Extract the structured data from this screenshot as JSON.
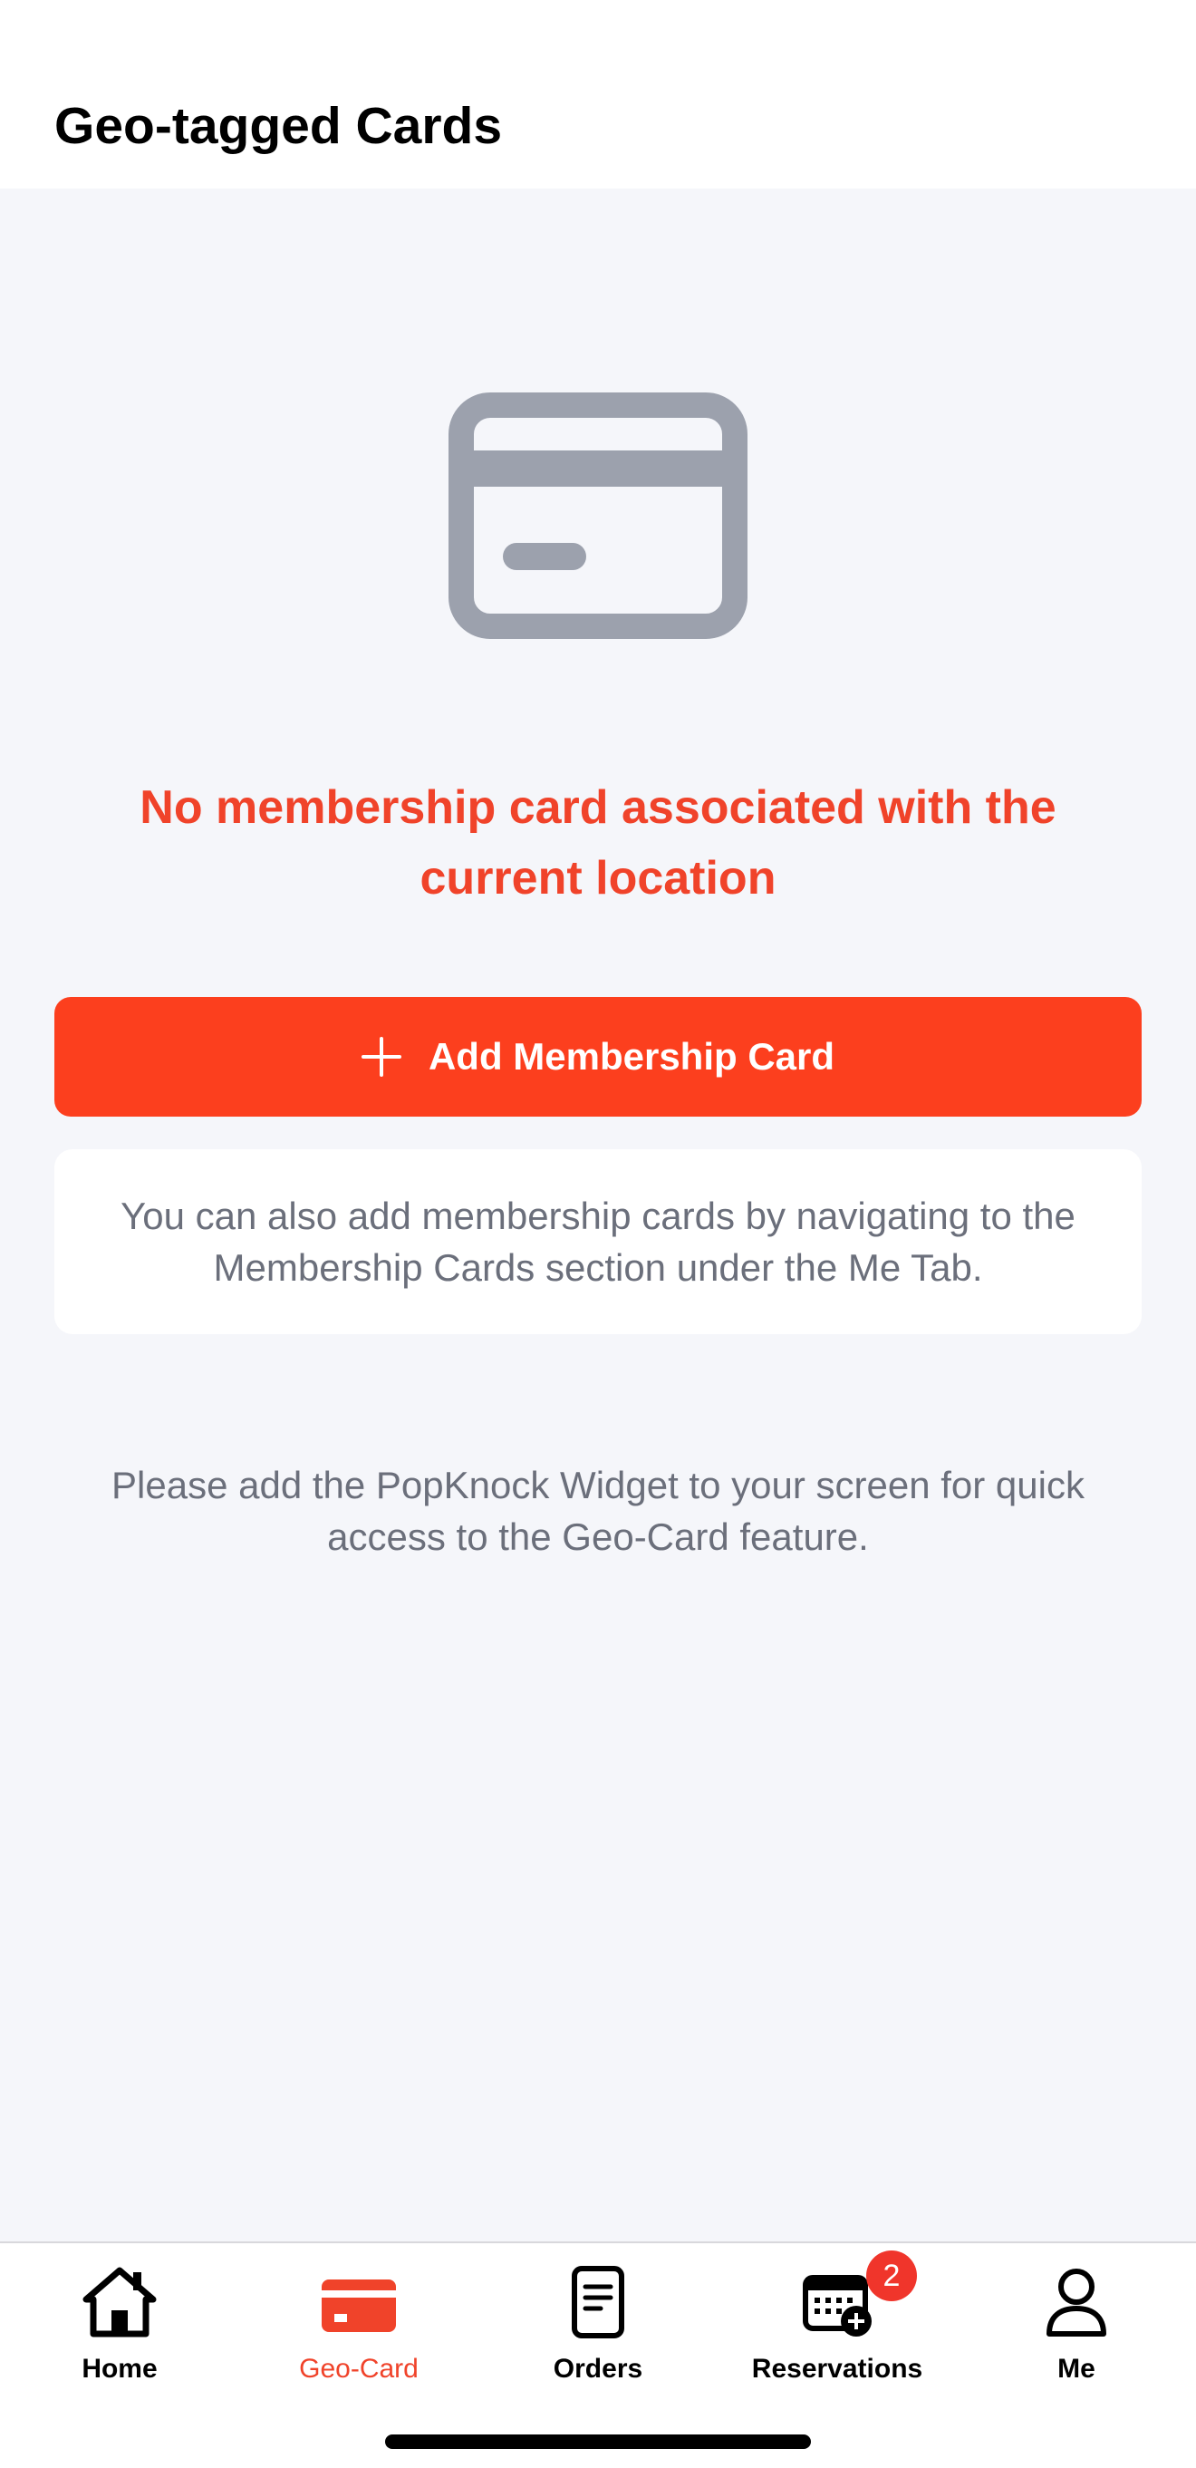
{
  "header": {
    "title": "Geo-tagged Cards"
  },
  "empty_state": {
    "icon": "credit-card-icon",
    "message": "No membership card associated with the current location"
  },
  "add_button": {
    "icon": "plus-icon",
    "label": "Add Membership Card"
  },
  "info_card": {
    "text": "You can also add membership cards by navigating to the Membership Cards section under the Me Tab."
  },
  "widget_hint": {
    "text": "Please add the PopKnock Widget to your screen for quick access to the Geo-Card feature."
  },
  "tabbar": {
    "items": [
      {
        "label": "Home",
        "icon": "home-icon"
      },
      {
        "label": "Geo-Card",
        "icon": "credit-card-icon",
        "active": true
      },
      {
        "label": "Orders",
        "icon": "document-icon"
      },
      {
        "label": "Reservations",
        "icon": "calendar-add-icon",
        "badge": "2"
      },
      {
        "label": "Me",
        "icon": "person-icon"
      }
    ]
  },
  "colors": {
    "accent": "#fc3f1e",
    "accent_text": "#f0432a",
    "muted_text": "#6b6f7b",
    "icon_gray": "#9ca1ad",
    "background": "#f5f6fa",
    "badge": "#f0352b"
  }
}
